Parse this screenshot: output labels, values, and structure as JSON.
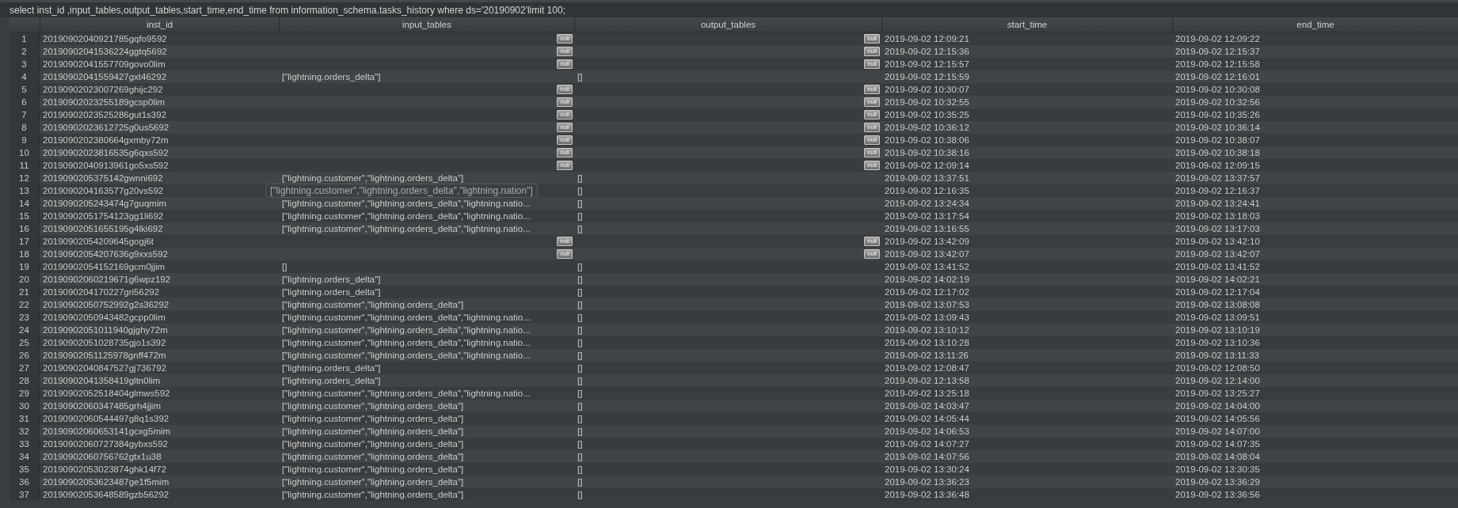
{
  "query": "select inst_id ,input_tables,output_tables,start_time,end_time from information_schema.tasks_history where ds='20190902'limit 100;",
  "table": {
    "columns": [
      "inst_id",
      "input_tables",
      "output_tables",
      "start_time",
      "end_time"
    ],
    "rows": [
      {
        "num": "1",
        "inst_id": "20190902040921785gqfo9592",
        "input_tables": {
          "kind": "null",
          "text": "null"
        },
        "output_tables": {
          "kind": "null",
          "text": "null"
        },
        "start_time": "2019-09-02 12:09:21",
        "end_time": "2019-09-02 12:09:22"
      },
      {
        "num": "2",
        "inst_id": "20190902041536224ggtq5692",
        "input_tables": {
          "kind": "null",
          "text": "null"
        },
        "output_tables": {
          "kind": "null",
          "text": "null"
        },
        "start_time": "2019-09-02 12:15:36",
        "end_time": "2019-09-02 12:15:37"
      },
      {
        "num": "3",
        "inst_id": "20190902041557709govo0lim",
        "input_tables": {
          "kind": "null",
          "text": "null"
        },
        "output_tables": {
          "kind": "null",
          "text": "null"
        },
        "start_time": "2019-09-02 12:15:57",
        "end_time": "2019-09-02 12:15:58"
      },
      {
        "num": "4",
        "inst_id": "20190902041559427gxt46292",
        "input_tables": {
          "kind": "text",
          "text": "[\"lightning.orders_delta\"]"
        },
        "output_tables": {
          "kind": "text",
          "text": "[]"
        },
        "start_time": "2019-09-02 12:15:59",
        "end_time": "2019-09-02 12:16:01"
      },
      {
        "num": "5",
        "inst_id": "20190902023007269ghijc292",
        "input_tables": {
          "kind": "null",
          "text": "null"
        },
        "output_tables": {
          "kind": "null",
          "text": "null"
        },
        "start_time": "2019-09-02 10:30:07",
        "end_time": "2019-09-02 10:30:08"
      },
      {
        "num": "6",
        "inst_id": "20190902023255189gcsp0lim",
        "input_tables": {
          "kind": "null",
          "text": "null"
        },
        "output_tables": {
          "kind": "null",
          "text": "null"
        },
        "start_time": "2019-09-02 10:32:55",
        "end_time": "2019-09-02 10:32:56"
      },
      {
        "num": "7",
        "inst_id": "20190902023525286gut1s392",
        "input_tables": {
          "kind": "null",
          "text": "null"
        },
        "output_tables": {
          "kind": "null",
          "text": "null"
        },
        "start_time": "2019-09-02 10:35:25",
        "end_time": "2019-09-02 10:35:26"
      },
      {
        "num": "8",
        "inst_id": "20190902023612725g0us5692",
        "input_tables": {
          "kind": "null",
          "text": "null"
        },
        "output_tables": {
          "kind": "null",
          "text": "null"
        },
        "start_time": "2019-09-02 10:36:12",
        "end_time": "2019-09-02 10:36:14"
      },
      {
        "num": "9",
        "inst_id": "2019090202380664gxmby72m",
        "input_tables": {
          "kind": "null",
          "text": "null"
        },
        "output_tables": {
          "kind": "null",
          "text": "null"
        },
        "start_time": "2019-09-02 10:38:06",
        "end_time": "2019-09-02 10:38:07"
      },
      {
        "num": "10",
        "inst_id": "20190902023816535g6qxs592",
        "input_tables": {
          "kind": "null",
          "text": "null"
        },
        "output_tables": {
          "kind": "null",
          "text": "null"
        },
        "start_time": "2019-09-02 10:38:16",
        "end_time": "2019-09-02 10:38:18"
      },
      {
        "num": "11",
        "inst_id": "20190902040913961go5xs592",
        "input_tables": {
          "kind": "null",
          "text": "null"
        },
        "output_tables": {
          "kind": "null",
          "text": "null"
        },
        "start_time": "2019-09-02 12:09:14",
        "end_time": "2019-09-02 12:09:15"
      },
      {
        "num": "12",
        "inst_id": "2019090205375142gwnni692",
        "input_tables": {
          "kind": "text",
          "text": "[\"lightning.customer\",\"lightning.orders_delta\"]"
        },
        "output_tables": {
          "kind": "text",
          "text": "[]"
        },
        "start_time": "2019-09-02 13:37:51",
        "end_time": "2019-09-02 13:37:57"
      },
      {
        "num": "13",
        "inst_id": "2019090204163577g20vs592",
        "output_tables": {
          "kind": "text",
          "text": "[]"
        },
        "start_time": "2019-09-02 12:16:35",
        "end_time": "2019-09-02 12:16:37"
      },
      {
        "num": "14",
        "inst_id": "2019090205243474g7guqmim",
        "input_tables": {
          "kind": "text",
          "text": "[\"lightning.customer\",\"lightning.orders_delta\",\"lightning.natio..."
        },
        "output_tables": {
          "kind": "text",
          "text": "[]"
        },
        "start_time": "2019-09-02 13:24:34",
        "end_time": "2019-09-02 13:24:41"
      },
      {
        "num": "15",
        "inst_id": "20190902051754123gg1li692",
        "input_tables": {
          "kind": "text",
          "text": "[\"lightning.customer\",\"lightning.orders_delta\",\"lightning.natio..."
        },
        "output_tables": {
          "kind": "text",
          "text": "[]"
        },
        "start_time": "2019-09-02 13:17:54",
        "end_time": "2019-09-02 13:18:03"
      },
      {
        "num": "16",
        "inst_id": "20190902051655195g4lki692",
        "input_tables": {
          "kind": "text",
          "text": "[\"lightning.customer\",\"lightning.orders_delta\",\"lightning.natio..."
        },
        "output_tables": {
          "kind": "text",
          "text": "[]"
        },
        "start_time": "2019-09-02 13:16:55",
        "end_time": "2019-09-02 13:17:03"
      },
      {
        "num": "17",
        "inst_id": "20190902054209645gogj6t",
        "input_tables": {
          "kind": "null",
          "text": "null"
        },
        "output_tables": {
          "kind": "null",
          "text": "null"
        },
        "start_time": "2019-09-02 13:42:09",
        "end_time": "2019-09-02 13:42:10"
      },
      {
        "num": "18",
        "inst_id": "20190902054207636g9xxs592",
        "input_tables": {
          "kind": "null",
          "text": "null"
        },
        "output_tables": {
          "kind": "null",
          "text": "null"
        },
        "start_time": "2019-09-02 13:42:07",
        "end_time": "2019-09-02 13:42:07"
      },
      {
        "num": "19",
        "inst_id": "20190902054152169gcm0jjim",
        "input_tables": {
          "kind": "text",
          "text": "[]"
        },
        "output_tables": {
          "kind": "text",
          "text": "[]"
        },
        "start_time": "2019-09-02 13:41:52",
        "end_time": "2019-09-02 13:41:52"
      },
      {
        "num": "20",
        "inst_id": "20190902060219671g6wpz192",
        "input_tables": {
          "kind": "text",
          "text": "[\"lightning.orders_delta\"]"
        },
        "output_tables": {
          "kind": "text",
          "text": "[]"
        },
        "start_time": "2019-09-02 14:02:19",
        "end_time": "2019-09-02 14:02:21"
      },
      {
        "num": "21",
        "inst_id": "2019090204170227gri56292",
        "input_tables": {
          "kind": "text",
          "text": "[\"lightning.orders_delta\"]"
        },
        "output_tables": {
          "kind": "text",
          "text": "[]"
        },
        "start_time": "2019-09-02 12:17:02",
        "end_time": "2019-09-02 12:17:04"
      },
      {
        "num": "22",
        "inst_id": "20190902050752992g2s36292",
        "input_tables": {
          "kind": "text",
          "text": "[\"lightning.customer\",\"lightning.orders_delta\"]"
        },
        "output_tables": {
          "kind": "text",
          "text": "[]"
        },
        "start_time": "2019-09-02 13:07:53",
        "end_time": "2019-09-02 13:08:08"
      },
      {
        "num": "23",
        "inst_id": "20190902050943482gcpp0lim",
        "input_tables": {
          "kind": "text",
          "text": "[\"lightning.customer\",\"lightning.orders_delta\",\"lightning.natio..."
        },
        "output_tables": {
          "kind": "text",
          "text": "[]"
        },
        "start_time": "2019-09-02 13:09:43",
        "end_time": "2019-09-02 13:09:51"
      },
      {
        "num": "24",
        "inst_id": "20190902051011940gjghy72m",
        "input_tables": {
          "kind": "text",
          "text": "[\"lightning.customer\",\"lightning.orders_delta\",\"lightning.natio..."
        },
        "output_tables": {
          "kind": "text",
          "text": "[]"
        },
        "start_time": "2019-09-02 13:10:12",
        "end_time": "2019-09-02 13:10:19"
      },
      {
        "num": "25",
        "inst_id": "20190902051028735gjo1s392",
        "input_tables": {
          "kind": "text",
          "text": "[\"lightning.customer\",\"lightning.orders_delta\",\"lightning.natio..."
        },
        "output_tables": {
          "kind": "text",
          "text": "[]"
        },
        "start_time": "2019-09-02 13:10:28",
        "end_time": "2019-09-02 13:10:36"
      },
      {
        "num": "26",
        "inst_id": "20190902051125978gnff472m",
        "input_tables": {
          "kind": "text",
          "text": "[\"lightning.customer\",\"lightning.orders_delta\",\"lightning.natio..."
        },
        "output_tables": {
          "kind": "text",
          "text": "[]"
        },
        "start_time": "2019-09-02 13:11:26",
        "end_time": "2019-09-02 13:11:33"
      },
      {
        "num": "27",
        "inst_id": "20190902040847527gj736792",
        "input_tables": {
          "kind": "text",
          "text": "[\"lightning.orders_delta\"]"
        },
        "output_tables": {
          "kind": "text",
          "text": "[]"
        },
        "start_time": "2019-09-02 12:08:47",
        "end_time": "2019-09-02 12:08:50"
      },
      {
        "num": "28",
        "inst_id": "20190902041358419gltn0lim",
        "input_tables": {
          "kind": "text",
          "text": "[\"lightning.orders_delta\"]"
        },
        "output_tables": {
          "kind": "text",
          "text": "[]"
        },
        "start_time": "2019-09-02 12:13:58",
        "end_time": "2019-09-02 12:14:00"
      },
      {
        "num": "29",
        "inst_id": "20190902052518404glmws592",
        "input_tables": {
          "kind": "text",
          "text": "[\"lightning.customer\",\"lightning.orders_delta\",\"lightning.natio..."
        },
        "output_tables": {
          "kind": "text",
          "text": "[]"
        },
        "start_time": "2019-09-02 13:25:18",
        "end_time": "2019-09-02 13:25:27"
      },
      {
        "num": "30",
        "inst_id": "20190902060347485grh4jjim",
        "input_tables": {
          "kind": "text",
          "text": "[\"lightning.customer\",\"lightning.orders_delta\"]"
        },
        "output_tables": {
          "kind": "text",
          "text": "[]"
        },
        "start_time": "2019-09-02 14:03:47",
        "end_time": "2019-09-02 14:04:00"
      },
      {
        "num": "31",
        "inst_id": "20190902060544497g8q1s392",
        "input_tables": {
          "kind": "text",
          "text": "[\"lightning.customer\",\"lightning.orders_delta\"]"
        },
        "output_tables": {
          "kind": "text",
          "text": "[]"
        },
        "start_time": "2019-09-02 14:05:44",
        "end_time": "2019-09-02 14:05:56"
      },
      {
        "num": "32",
        "inst_id": "20190902060653141gcxg5mim",
        "input_tables": {
          "kind": "text",
          "text": "[\"lightning.customer\",\"lightning.orders_delta\"]"
        },
        "output_tables": {
          "kind": "text",
          "text": "[]"
        },
        "start_time": "2019-09-02 14:06:53",
        "end_time": "2019-09-02 14:07:00"
      },
      {
        "num": "33",
        "inst_id": "20190902060727384gybxs592",
        "input_tables": {
          "kind": "text",
          "text": "[\"lightning.customer\",\"lightning.orders_delta\"]"
        },
        "output_tables": {
          "kind": "text",
          "text": "[]"
        },
        "start_time": "2019-09-02 14:07:27",
        "end_time": "2019-09-02 14:07:35"
      },
      {
        "num": "34",
        "inst_id": "20190902060756762gtx1u38",
        "input_tables": {
          "kind": "text",
          "text": "[\"lightning.customer\",\"lightning.orders_delta\"]"
        },
        "output_tables": {
          "kind": "text",
          "text": "[]"
        },
        "start_time": "2019-09-02 14:07:56",
        "end_time": "2019-09-02 14:08:04"
      },
      {
        "num": "35",
        "inst_id": "20190902053023874ghk14f72",
        "input_tables": {
          "kind": "text",
          "text": "[\"lightning.customer\",\"lightning.orders_delta\"]"
        },
        "output_tables": {
          "kind": "text",
          "text": "[]"
        },
        "start_time": "2019-09-02 13:30:24",
        "end_time": "2019-09-02 13:30:35"
      },
      {
        "num": "36",
        "inst_id": "20190902053623487ge1f5mim",
        "input_tables": {
          "kind": "text",
          "text": "[\"lightning.customer\",\"lightning.orders_delta\"]"
        },
        "output_tables": {
          "kind": "text",
          "text": "[]"
        },
        "start_time": "2019-09-02 13:36:23",
        "end_time": "2019-09-02 13:36:29"
      },
      {
        "num": "37",
        "inst_id": "20190902053648589gzb56292",
        "input_tables": {
          "kind": "text",
          "text": "[\"lightning.customer\",\"lightning.orders_delta\"]"
        },
        "output_tables": {
          "kind": "text",
          "text": "[]"
        },
        "start_time": "2019-09-02 13:36:48",
        "end_time": "2019-09-02 13:36:56"
      }
    ]
  },
  "tooltip": "[\"lightning.customer\",\"lightning.orders_delta\",\"lightning.nation\"]"
}
